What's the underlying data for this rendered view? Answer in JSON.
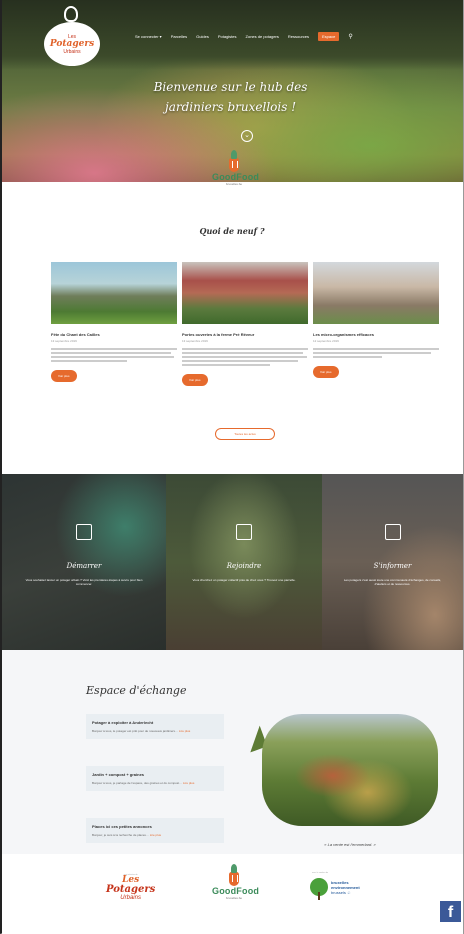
{
  "header": {
    "logo_line1": "Les",
    "logo_line2": "Potagers",
    "logo_line3": "Urbains",
    "nav": [
      "Se connecter ▾",
      "Parcelles",
      "Guides",
      "Potagistes",
      "Zones de potagers",
      "Ressources"
    ],
    "nav_cta": "Espace",
    "hero_title_line1": "Bienvenue sur le hub des",
    "hero_title_line2": "jardiniers bruxellois !",
    "scroll_glyph": "⌄"
  },
  "goodfood_top": {
    "word": "GoodFood",
    "sub": "bruxelles.be"
  },
  "news": {
    "heading": "Quoi de neuf ?",
    "cards": [
      {
        "title": "Fête du Chant des Cailles",
        "date": "13 septembre 2019",
        "button": "Voir plus"
      },
      {
        "title": "Portes ouvertes à la ferme Pré Rêveur",
        "date": "13 septembre 2019",
        "button": "Voir plus"
      },
      {
        "title": "Les micro-organismes efficaces",
        "date": "12 septembre 2019",
        "button": "Voir plus"
      }
    ],
    "all_button": "Toutes les actus"
  },
  "panels": [
    {
      "title": "Démarrer",
      "text": "Vous souhaitez lancer un potager urbain ? Voici les premières étapes à suivre pour bien commencer."
    },
    {
      "title": "Rejoindre",
      "text": "Vous cherchez un potager collectif près de chez vous ? Trouvez une parcelle."
    },
    {
      "title": "S'informer",
      "text": "Les potagers c'est aussi toute une communauté d'échanges, de conseils, d'ateliers et de ressources."
    }
  ],
  "espace": {
    "title": "Espace d'échange",
    "boxes": [
      {
        "title": "Potager à exploiter à Anderlecht",
        "body": "Bonjour à tous, le potager est prêt pour de nouveaux jardiniers…",
        "link": "Lire plus"
      },
      {
        "title": "Jardin + compost + graines",
        "body": "Bonjour à tous, je partage de l'espace, des graines et du compost…",
        "link": "Lire plus"
      },
      {
        "title": "Places ici ces petites annonces",
        "body": "Bonjour, je suis à la recherche de places…",
        "link": "Lire plus"
      }
    ],
    "caption": "« La vente est l'emmerlard. »"
  },
  "footer": {
    "pu_sup": "une initiative de",
    "pu_line1": "Les",
    "pu_line2": "Potagers",
    "pu_line3": "Urbains",
    "goodfood_word": "GoodFood",
    "goodfood_sub": "bruxelles.be",
    "be_sup": "avec le soutien de",
    "be_line1": "bruxelles",
    "be_line2": "environnement",
    "be_line3": "brussels ♧",
    "fb": "f"
  }
}
